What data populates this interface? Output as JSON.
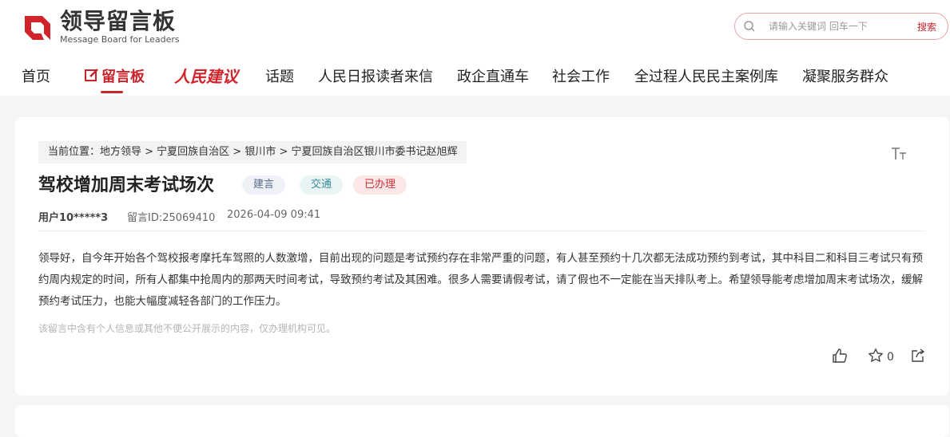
{
  "header": {
    "logo_cn": "领导留言板",
    "logo_en": "Message Board for Leaders"
  },
  "search": {
    "placeholder": "请输入关键词 回车一下",
    "button_label": "搜索"
  },
  "nav": {
    "items": [
      {
        "label": "首页"
      },
      {
        "label": "留言板"
      },
      {
        "label": "人民建议"
      },
      {
        "label": "话题"
      },
      {
        "label": "人民日报读者来信"
      },
      {
        "label": "政企直通车"
      },
      {
        "label": "社会工作"
      },
      {
        "label": "全过程人民民主案例库"
      },
      {
        "label": "凝聚服务群众"
      }
    ],
    "active": "留言板"
  },
  "colors": {
    "brand": "#c8222b",
    "background": "#f4f5f7"
  },
  "message": {
    "breadcrumb": "当前位置：地方领导 > 宁夏回族自治区 > 银川市 > 宁夏回族自治区银川市委书记赵旭辉",
    "title": "驾校增加周末考试场次",
    "tags": [
      "建言",
      "交通",
      "已办理"
    ],
    "user": "用户10*****3",
    "id": "留言ID:25069410",
    "time": "2026-04-09 09:41",
    "content": "领导好，自今年开始各个驾校报考摩托车驾照的人数激增，目前出现的问题是考试预约存在非常严重的问题，有人甚至预约十几次都无法成功预约到考试，其中科目二和科目三考试只有预约周内规定的时间，所有人都集中抢周内的那两天时间考试，导致预约考试及其困难。很多人需要请假考试，请了假也不一定能在当天排队考上。希望领导能考虑增加周末考试场次，缓解预约考试压力，也能大幅度减轻各部门的工作压力。",
    "notice": "该留言中含有个人信息或其他不便公开展示的内容，仅办理机构可见。",
    "favorite_count": "0"
  },
  "icons": {
    "search": "search-icon",
    "font_size": "font-size-icon",
    "like": "thumbs-up-icon",
    "favorite": "star-icon",
    "share": "share-icon"
  }
}
